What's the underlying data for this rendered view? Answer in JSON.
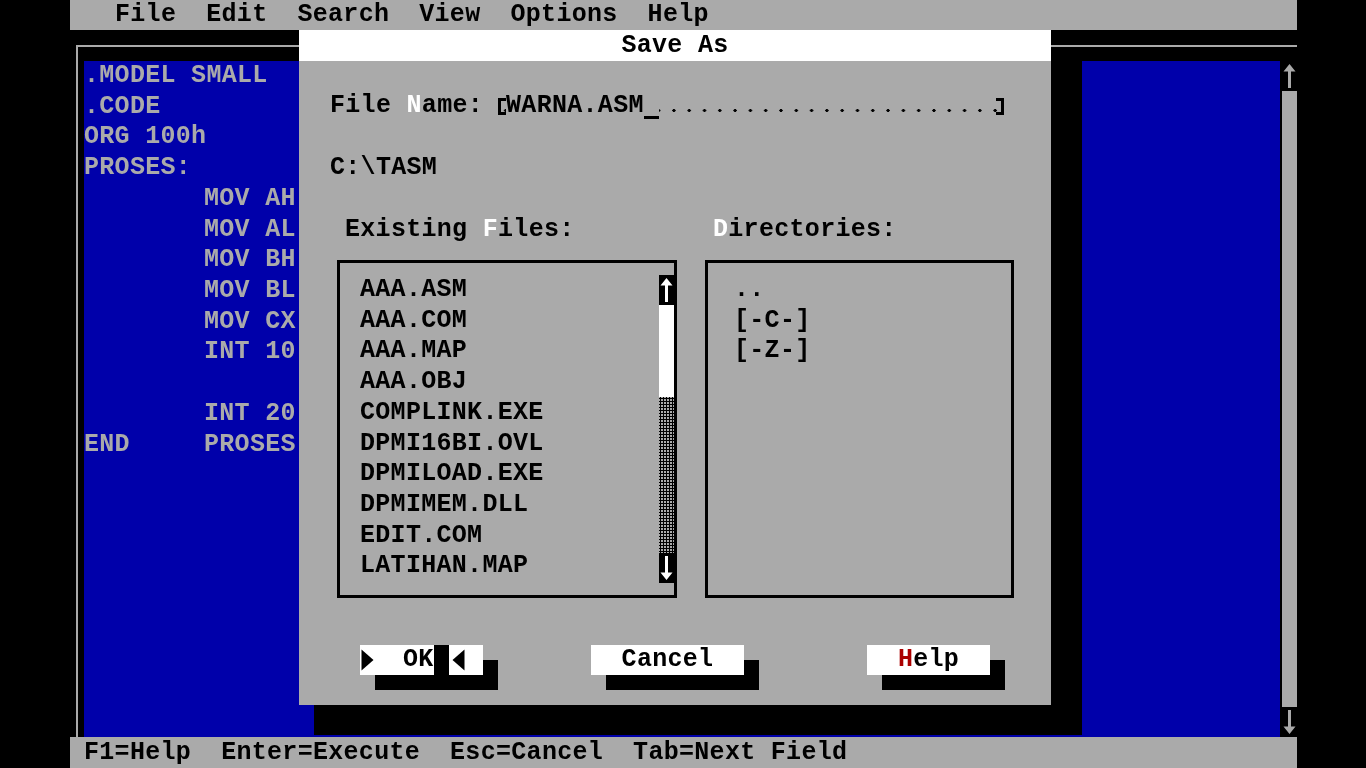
{
  "menu_bar": {
    "items": [
      "File",
      "Edit",
      "Search",
      "View",
      "Options",
      "Help"
    ]
  },
  "editor": {
    "lines": [
      {
        "kind": "code",
        "label": ".MODEL SMALL"
      },
      {
        "kind": "code",
        "label": ".CODE"
      },
      {
        "kind": "code",
        "label": "ORG 100h"
      },
      {
        "kind": "code",
        "label": "PROSES:"
      },
      {
        "kind": "code",
        "op": "MOV AH"
      },
      {
        "kind": "code",
        "op": "MOV AL"
      },
      {
        "kind": "code",
        "op": "MOV BH"
      },
      {
        "kind": "code",
        "op": "MOV BL"
      },
      {
        "kind": "code",
        "op": "MOV CX"
      },
      {
        "kind": "code",
        "op": "INT 10"
      },
      {
        "kind": "blank"
      },
      {
        "kind": "code",
        "op": "INT 20"
      },
      {
        "kind": "code",
        "label": "END",
        "op": "PROSES"
      }
    ]
  },
  "dialog": {
    "title": "Save As",
    "file_name": {
      "label_parts": [
        {
          "text": "File ",
          "hotkey": false
        },
        {
          "text": "N",
          "hotkey": true
        },
        {
          "text": "ame:",
          "hotkey": false
        }
      ],
      "value": "WARNA.ASM"
    },
    "path": "C:\\TASM",
    "existing_files": {
      "label_parts": [
        {
          "text": "Existing ",
          "hotkey": false
        },
        {
          "text": "F",
          "hotkey": true
        },
        {
          "text": "iles:",
          "hotkey": false
        }
      ],
      "items": [
        "AAA.ASM",
        "AAA.COM",
        "AAA.MAP",
        "AAA.OBJ",
        "COMPLINK.EXE",
        "DPMI16BI.OVL",
        "DPMILOAD.EXE",
        "DPMIMEM.DLL",
        "EDIT.COM",
        "LATIHAN.MAP"
      ]
    },
    "directories": {
      "label_parts": [
        {
          "text": "D",
          "hotkey": true
        },
        {
          "text": "irectories:",
          "hotkey": false
        }
      ],
      "items": [
        "..",
        "[-C-]",
        "[-Z-]"
      ]
    },
    "buttons": [
      {
        "label_parts": [
          {
            "text": "OK",
            "hotkey": false
          }
        ],
        "default": true
      },
      {
        "label_parts": [
          {
            "text": "Cancel",
            "hotkey": false
          }
        ],
        "default": false
      },
      {
        "label_parts": [
          {
            "text": "H",
            "hotkey": true
          },
          {
            "text": "elp",
            "hotkey": false
          }
        ],
        "default": false
      }
    ]
  },
  "status_bar": {
    "items": [
      "F1=Help",
      "Enter=Execute",
      "Esc=Cancel",
      "Tab=Next Field"
    ]
  }
}
